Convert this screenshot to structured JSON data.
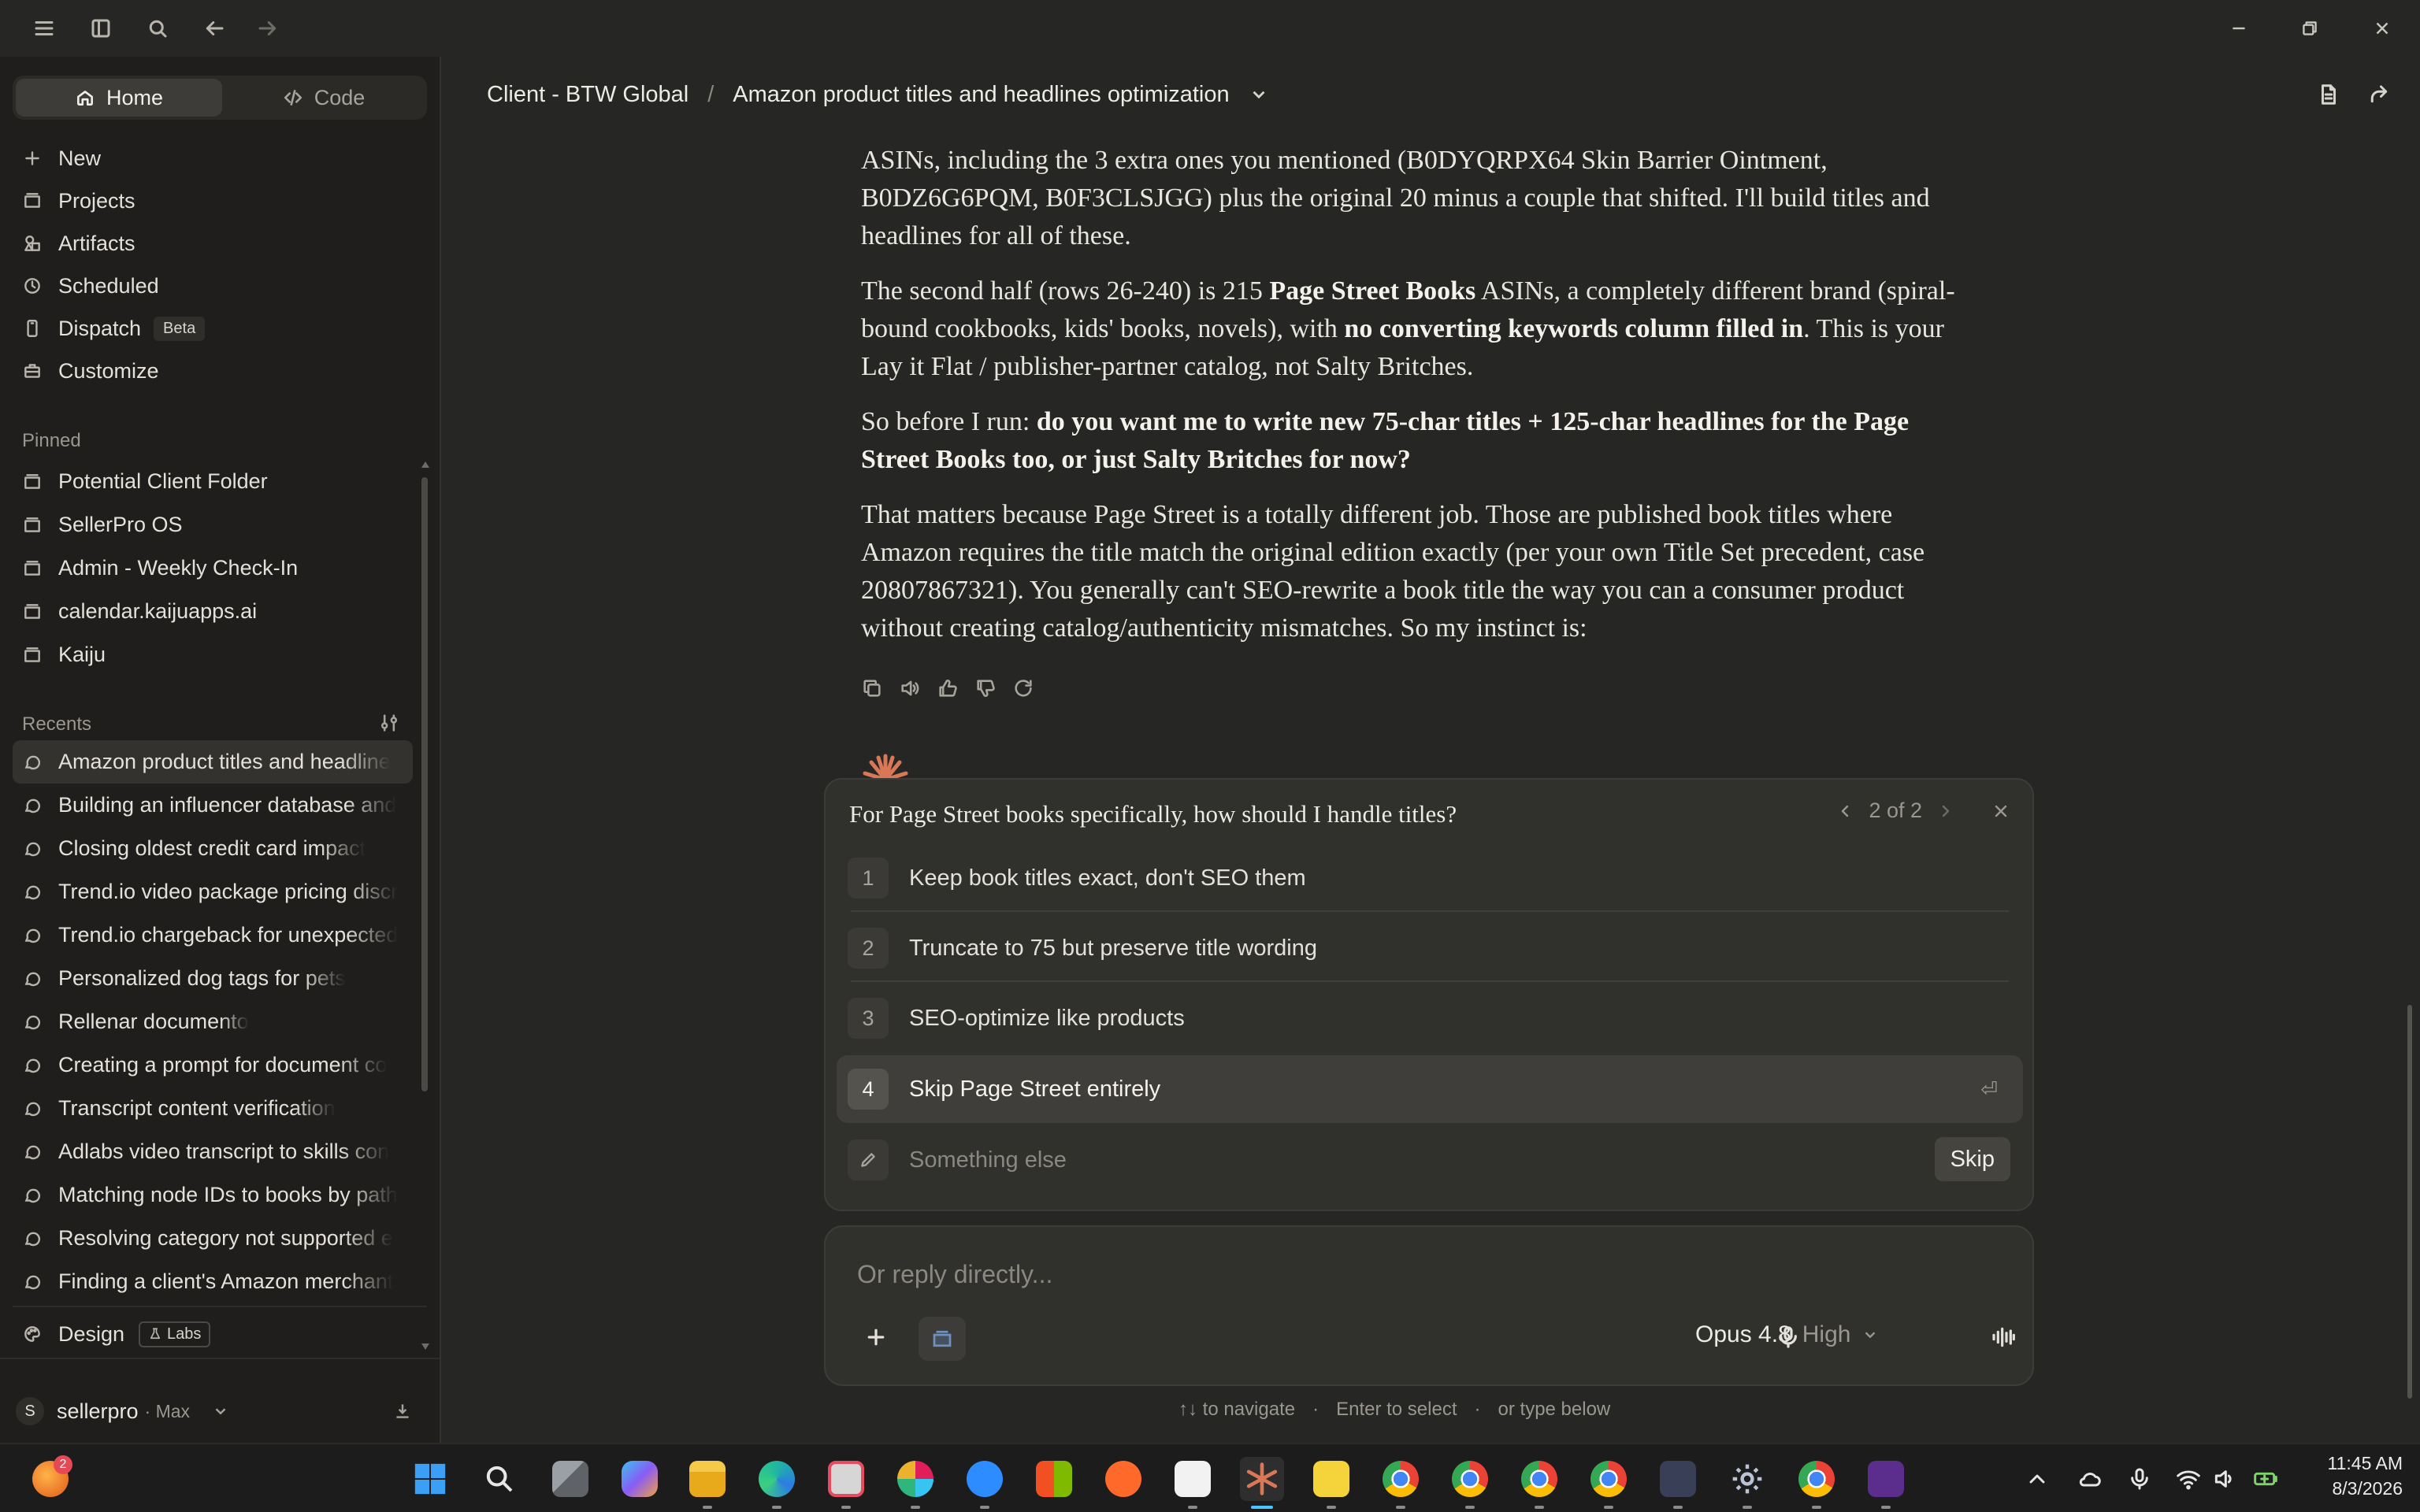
{
  "mode_toggle": {
    "home_label": "Home",
    "code_label": "Code"
  },
  "sidebar": {
    "nav": [
      {
        "label": "New",
        "icon": "plus-icon"
      },
      {
        "label": "Projects",
        "icon": "folder-icon"
      },
      {
        "label": "Artifacts",
        "icon": "shapes-icon"
      },
      {
        "label": "Scheduled",
        "icon": "clock-icon"
      },
      {
        "label": "Dispatch",
        "icon": "phone-icon",
        "badge": "Beta"
      },
      {
        "label": "Customize",
        "icon": "toolbox-icon"
      }
    ],
    "pinned_label": "Pinned",
    "pinned": [
      "Potential Client Folder",
      "SellerPro OS",
      "Admin - Weekly Check-In",
      "calendar.kaijuapps.ai",
      "Kaiju"
    ],
    "recents_label": "Recents",
    "recents": [
      "Amazon product titles and headline",
      "Building an influencer database and",
      "Closing oldest credit card impact",
      "Trend.io video package pricing discr",
      "Trend.io chargeback for unexpected",
      "Personalized dog tags for pets",
      "Rellenar documento",
      "Creating a prompt for document co",
      "Transcript content verification",
      "Adlabs video transcript to skills con",
      "Matching node IDs to books by path",
      "Resolving category not supported e",
      "Finding a client's Amazon merchant"
    ],
    "design_label": "Design",
    "labs_label": "Labs",
    "user": {
      "initial": "S",
      "name": "sellerpro",
      "plan": "· Max"
    }
  },
  "header": {
    "project": "Client - BTW Global",
    "separator": "/",
    "chat_title": "Amazon product titles and headlines optimization"
  },
  "message": {
    "p1_a": "ASINs, including the 3 extra ones you mentioned (B0DYQRPX64 Skin Barrier Ointment, B0DZ6G6PQM, B0F3CLSJGG) plus the original 20 minus a couple that shifted. I'll build titles and headlines for all of these.",
    "p2_a": "The second half (rows 26-240) is 215 ",
    "p2_b": "Page Street Books",
    "p2_c": " ASINs, a completely different brand (spiral-bound cookbooks, kids' books, novels), with ",
    "p2_d": "no converting keywords column filled in",
    "p2_e": ". This is your Lay it Flat / publisher-partner catalog, not Salty Britches.",
    "p3_a": "So before I run: ",
    "p3_b": "do you want me to write new 75-char titles + 125-char headlines for the Page Street Books too, or just Salty Britches for now?",
    "p4": "That matters because Page Street is a totally different job. Those are published book titles where Amazon requires the title match the original edition exactly (per your own Title Set precedent, case 20807867321). You generally can't SEO-rewrite a book title the way you can a consumer product without creating catalog/authenticity mismatches. So my instinct is:"
  },
  "question": {
    "title": "For Page Street books specifically, how should I handle titles?",
    "pager": "2 of 2",
    "options": [
      {
        "num": "1",
        "label": "Keep book titles exact, don't SEO them"
      },
      {
        "num": "2",
        "label": "Truncate to 75 but preserve title wording"
      },
      {
        "num": "3",
        "label": "SEO-optimize like products"
      },
      {
        "num": "4",
        "label": "Skip Page Street entirely"
      }
    ],
    "selected": 4,
    "enter_glyph": "⏎",
    "other_placeholder": "Something else",
    "skip_label": "Skip"
  },
  "composer": {
    "placeholder": "Or reply directly...",
    "model": "Opus 4.8",
    "effort": "High"
  },
  "hints": {
    "navigate": "↑↓ to navigate",
    "select": "Enter to select",
    "type": "or type below",
    "dot": "·"
  },
  "taskbar": {
    "notification_count": "2",
    "time": "11:45 AM",
    "date": "8/3/2026"
  },
  "colors": {
    "background": "#262624",
    "sidebar": "#1f1e1d",
    "panel": "#30302d",
    "accent_claude": "#d97757",
    "taskbar_active": "#4cc2ff"
  }
}
